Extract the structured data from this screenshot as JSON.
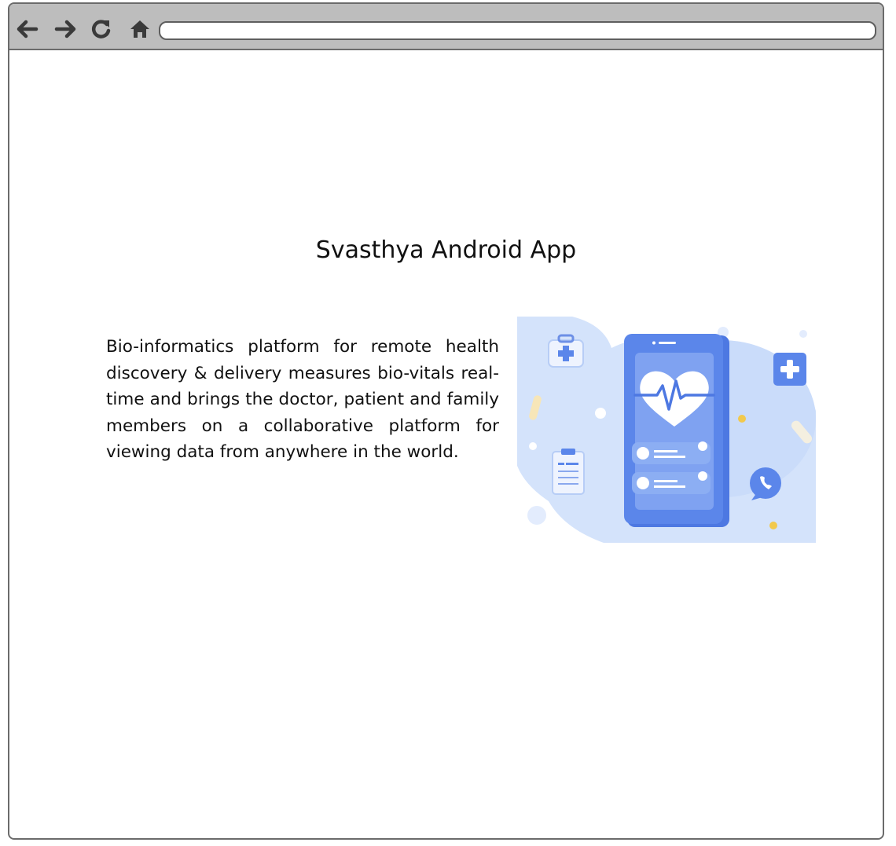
{
  "browser": {
    "back_icon": "back-arrow-icon",
    "forward_icon": "forward-arrow-icon",
    "reload_icon": "reload-icon",
    "home_icon": "home-icon",
    "address_value": ""
  },
  "page": {
    "title": "Svasthya Android App",
    "description": "Bio-informatics platform for remote health discovery & delivery measures bio-vitals real-time and brings the doctor, patient and family members on a collaborative platform for viewing data from anywhere in the world.",
    "illustration": {
      "subject": "smartphone-health-illustration",
      "colors": {
        "background_blob": "#cfe0fb",
        "phone_body": "#5b86ea",
        "phone_screen": "#7fa2f1",
        "accent_white": "#ffffff",
        "accent_yellow": "#f2c94c"
      }
    }
  }
}
